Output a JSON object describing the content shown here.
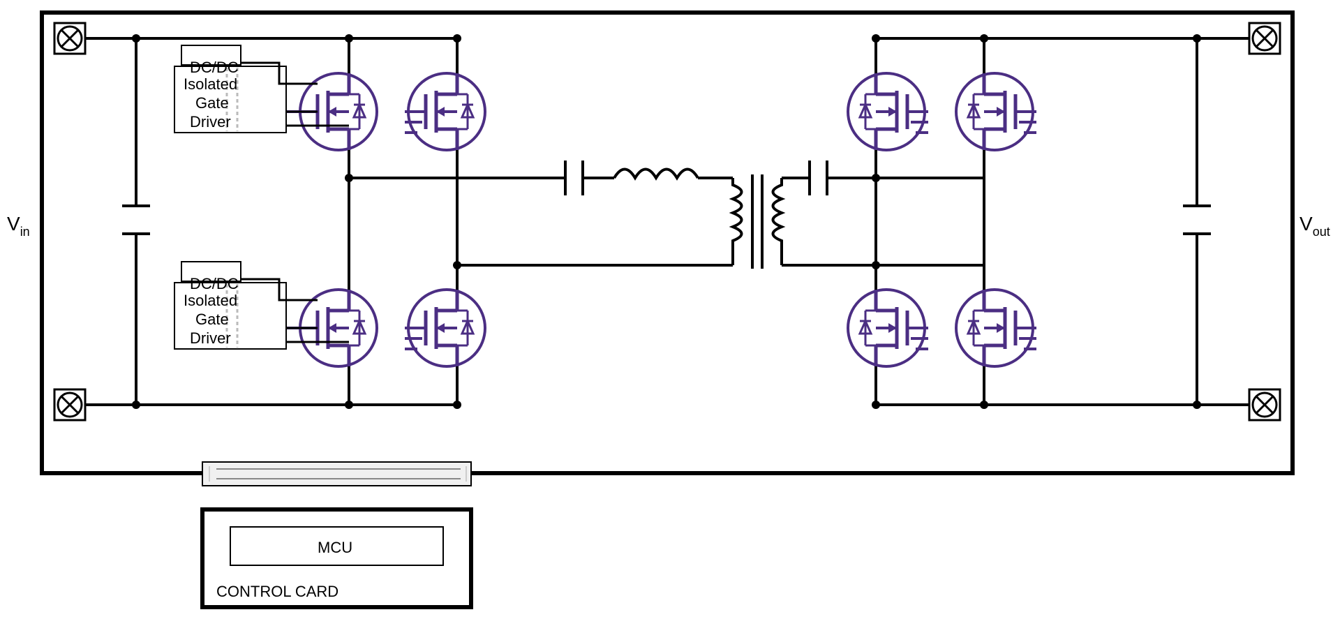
{
  "labels": {
    "vin": "V",
    "vin_sub": "in",
    "vout": "V",
    "vout_sub": "out",
    "dcdc": "DC/DC",
    "gate_driver_line1": "Isolated",
    "gate_driver_line2": "Gate",
    "gate_driver_line3": "Driver",
    "mcu": "MCU",
    "control_card": "CONTROL CARD"
  },
  "colors": {
    "mosfet": "#4B2E83",
    "wire": "#000000",
    "connector_fill": "#f0f0f0"
  }
}
